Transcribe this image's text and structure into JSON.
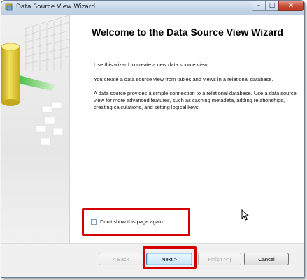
{
  "window": {
    "title": "Data Source View Wizard",
    "controls": {
      "minimize": "–",
      "maximize": "□",
      "close": "✕"
    }
  },
  "heading": "Welcome to the Data Source View Wizard",
  "paragraphs": [
    "Use this wizard to create a new data source view.",
    "You create a data source view from tables and views in a relational database.",
    "A data source provides a simple connection to a relational database. Use a data source view for more advanced features, such as caching metadata, adding relationships, creating calculations, and setting logical keys."
  ],
  "dont_show": {
    "label": "Don't show this page again",
    "checked": false
  },
  "buttons": {
    "back": "< Back",
    "next": "Next >",
    "finish": "Finish >>|",
    "cancel": "Cancel"
  },
  "colors": {
    "highlight": "#d40000",
    "title_bar": "#c7d7ea",
    "close_button": "#c74a32"
  },
  "icons": [
    "wizard-app-icon",
    "wizard-banner-graphic",
    "mouse-cursor-icon"
  ]
}
